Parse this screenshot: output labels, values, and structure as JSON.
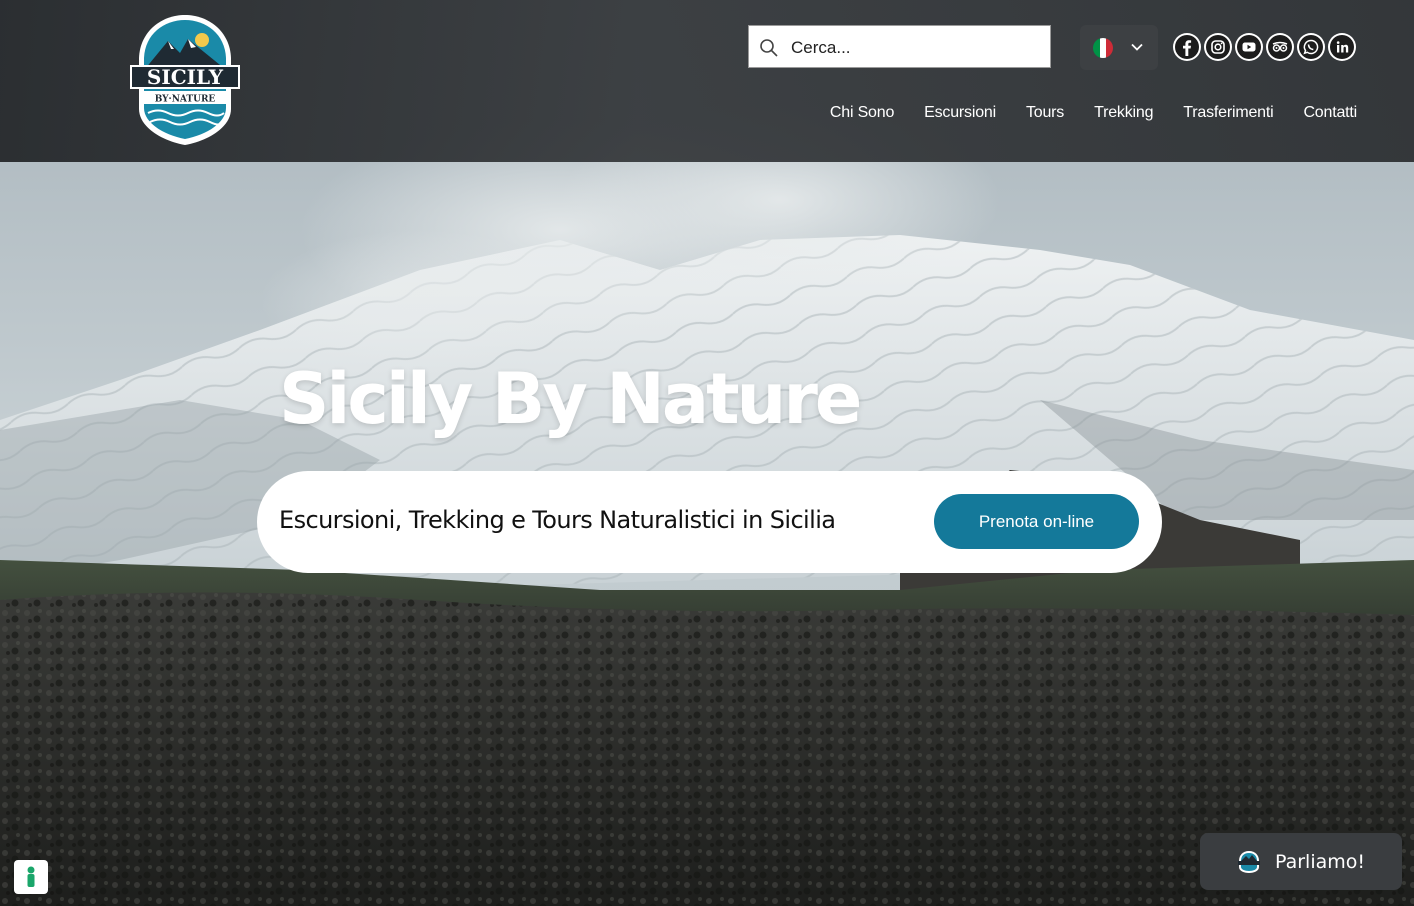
{
  "brand": {
    "logo_text": "SICILY",
    "logo_sub": "BY·NATURE"
  },
  "header": {
    "search": {
      "placeholder": "Cerca..."
    },
    "language": {
      "selected": "Italiano",
      "flag_colors": [
        "#009246",
        "#ffffff",
        "#ce2b37"
      ]
    },
    "social": [
      {
        "icon": "facebook-icon"
      },
      {
        "icon": "instagram-icon"
      },
      {
        "icon": "youtube-icon"
      },
      {
        "icon": "tripadvisor-icon"
      },
      {
        "icon": "whatsapp-icon"
      },
      {
        "icon": "linkedin-icon"
      }
    ],
    "nav": [
      "Chi Sono",
      "Escursioni",
      "Tours",
      "Trekking",
      "Trasferimenti",
      "Contatti"
    ]
  },
  "hero": {
    "title": "Sicily By Nature",
    "tagline": "Escursioni, Trekking e Tours Naturalistici in Sicilia",
    "cta": "Prenota on-line"
  },
  "chat": {
    "label": "Parliamo!"
  },
  "colors": {
    "accent": "#14799a",
    "header_bg": "#2f3235"
  }
}
